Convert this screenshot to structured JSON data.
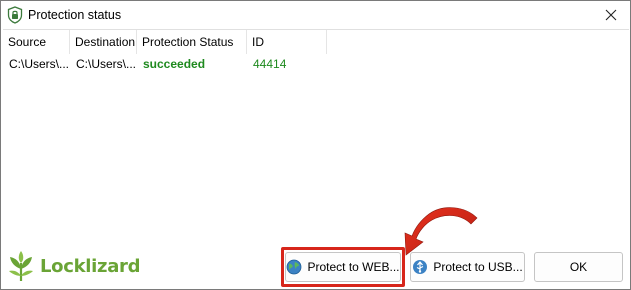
{
  "window": {
    "title": "Protection status",
    "close_icon": "close-icon"
  },
  "table": {
    "columns": [
      "Source",
      "Destination",
      "Protection Status",
      "ID"
    ],
    "rows": [
      {
        "source": "C:\\Users\\...",
        "destination": "C:\\Users\\...",
        "status": "succeeded",
        "id": "44414"
      }
    ]
  },
  "footer": {
    "logo_text": "Locklizard",
    "protect_web_label": "Protect to WEB...",
    "protect_usb_label": "Protect to USB...",
    "ok_label": "OK"
  },
  "colors": {
    "success": "#1f8a1f",
    "logo_green": "#6aa436",
    "highlight_red": "#d7261b"
  }
}
